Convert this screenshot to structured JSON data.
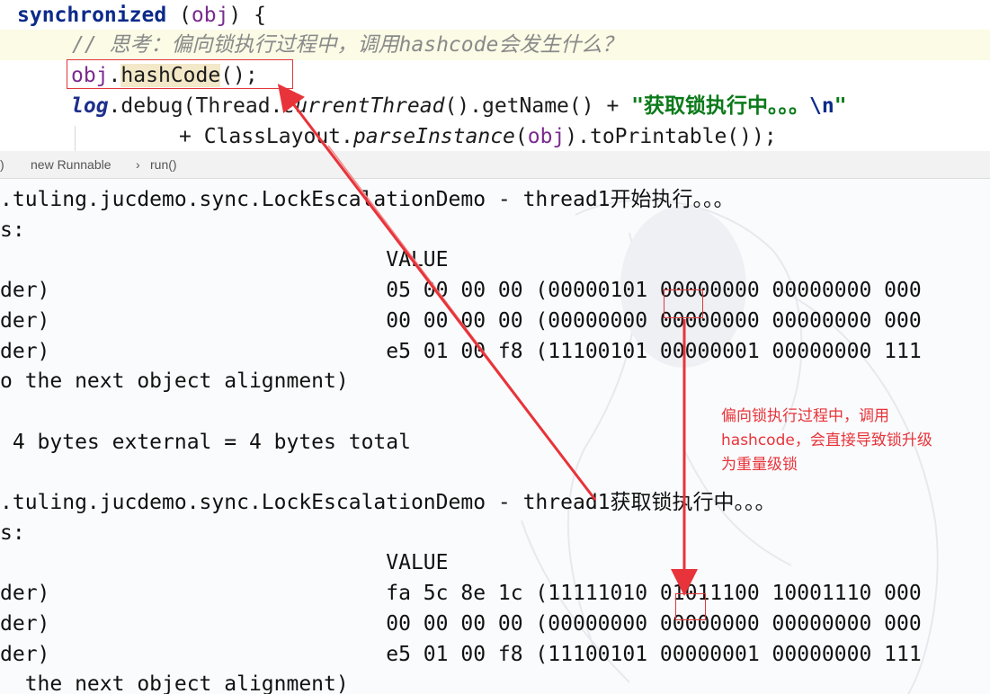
{
  "editor": {
    "lines": {
      "sync_kw": "synchronized",
      "sync_rest": " (",
      "sync_var": "obj",
      "sync_end": ") {",
      "comment": "// 思考：偏向锁执行过程中，调用hashcode会发生什么？",
      "hash_var": "obj",
      "hash_dot": ".",
      "hash_call": "hashCode",
      "hash_end": "();",
      "log_field": "log",
      "log_debug": ".debug(Thread.",
      "log_ct": "currentThread",
      "log_mid": "().getName() + ",
      "log_str": "\"获取锁执行中。。。",
      "log_esc": "\\n",
      "log_strend": "\"",
      "cl_plus": "+ ClassLayout.",
      "cl_parse": "parseInstance",
      "cl_open": "(",
      "cl_var": "obj",
      "cl_end": ").toPrintable());"
    }
  },
  "breadcrumb": {
    "sep0": ")",
    "item1": "new Runnable",
    "sep1": "›",
    "item2": "run()"
  },
  "console": {
    "lines": [
      ".tuling.jucdemo.sync.LockEscalationDemo - thread1开始执行。。。",
      "s:",
      "                               VALUE",
      "der)                           05 00 00 00 (00000101 00000000 00000000 000",
      "der)                           00 00 00 00 (00000000 00000000 00000000 000",
      "der)                           e5 01 00 f8 (11100101 00000001 00000000 111",
      "o the next object alignment)",
      "",
      " 4 bytes external = 4 bytes total",
      "",
      ".tuling.jucdemo.sync.LockEscalationDemo - thread1获取锁执行中。。。",
      "s:",
      "                               VALUE",
      "der)                           fa 5c 8e 1c (11111010 01011100 10001110 000",
      "der)                           00 00 00 00 (00000000 00000000 00000000 000",
      "der)                           e5 01 00 f8 (11100101 00000001 00000000 111",
      "  the next object alignment)"
    ]
  },
  "annotation": {
    "line1": "偏向锁执行过程中，调用",
    "line2": "hashcode，会直接导致锁升级",
    "line3": "为重量级锁"
  },
  "colors": {
    "annotation": "#e8333a",
    "keyword": "#0b2a8a",
    "string": "#0b7a1a",
    "variable": "#7a2b8f",
    "comment": "#8a8a8a"
  }
}
